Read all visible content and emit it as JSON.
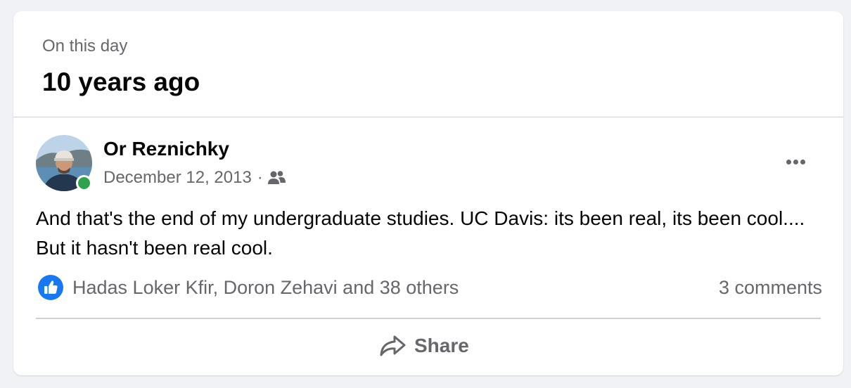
{
  "memory": {
    "section_label": "On this day",
    "years_ago": "10 years ago"
  },
  "post": {
    "author": "Or Reznichky",
    "date": "December 12, 2013",
    "meta_separator": "·",
    "audience_icon": "friends-icon",
    "online_status_color": "#31a24c",
    "text": "And that's the end of my undergraduate studies. UC Davis: its been real, its been cool.... But it hasn't been real cool.",
    "reactions": {
      "icon": "like-icon",
      "like_color": "#1877f2",
      "summary": "Hadas Loker Kfir, Doron Zehavi and 38 others"
    },
    "comments": "3 comments",
    "more_icon": "more-options-icon"
  },
  "actions": {
    "share_label": "Share",
    "share_icon": "share-icon"
  }
}
